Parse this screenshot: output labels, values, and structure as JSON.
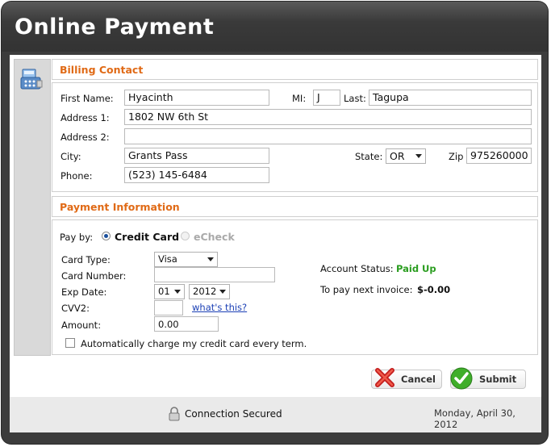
{
  "window": {
    "title": "Online Payment"
  },
  "billing": {
    "header": "Billing Contact",
    "first_name_label": "First Name:",
    "first_name": "Hyacinth",
    "mi_label": "MI:",
    "mi": "J",
    "last_label": "Last:",
    "last_name": "Tagupa",
    "address1_label": "Address 1:",
    "address1": "1802 NW 6th St",
    "address2_label": "Address 2:",
    "address2": "",
    "city_label": "City:",
    "city": "Grants Pass",
    "state_label": "State:",
    "state": "OR",
    "zip_label": "Zip",
    "zip": "975260000",
    "phone_label": "Phone:",
    "phone": "(523) 145-6484"
  },
  "payment": {
    "header": "Payment Information",
    "pay_by_label": "Pay by:",
    "option_credit": "Credit Card",
    "option_echeck": "eCheck",
    "selected_option": "Credit Card",
    "card_type_label": "Card Type:",
    "card_type": "Visa",
    "card_number_label": "Card Number:",
    "card_number": "",
    "exp_label": "Exp Date:",
    "exp_month": "01",
    "exp_year": "2012",
    "cvv_label": "CVV2:",
    "cvv": "",
    "whats_this": "what's this?",
    "amount_label": "Amount:",
    "amount": "0.00",
    "auto_charge_label": "Automatically charge my credit card every term.",
    "auto_charge_checked": false,
    "account_status_label": "Account Status:",
    "account_status": "Paid Up",
    "next_invoice_label": "To pay next invoice:",
    "next_invoice": "$-0.00"
  },
  "actions": {
    "cancel": "Cancel",
    "submit": "Submit"
  },
  "footer": {
    "security": "Connection Secured",
    "date": "Monday, April 30, 2012"
  },
  "colors": {
    "accent": "#e06a16",
    "status_green": "#2a9d1f",
    "link": "#1a3fb5",
    "titlebar": "#3c3c3c"
  },
  "icons": {
    "side": "cash-register-icon",
    "cancel": "red-x-icon",
    "submit": "green-check-icon",
    "lock": "padlock-icon"
  }
}
